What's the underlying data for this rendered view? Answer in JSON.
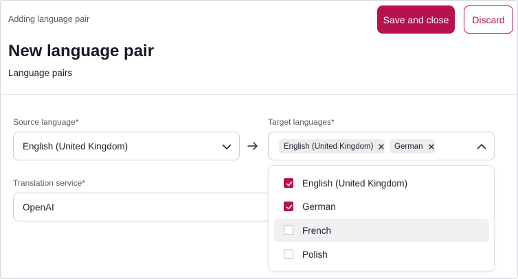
{
  "header": {
    "breadcrumb": "Adding language pair",
    "save_label": "Save and close",
    "discard_label": "Discard",
    "title": "New language pair",
    "subtitle": "Language pairs"
  },
  "form": {
    "source": {
      "label": "Source language*",
      "value": "English (United Kingdom)"
    },
    "target": {
      "label": "Target languages*",
      "chips": [
        "English (United Kingdom)",
        "German"
      ],
      "options": [
        {
          "label": "English (United Kingdom)",
          "checked": true
        },
        {
          "label": "German",
          "checked": true
        },
        {
          "label": "French",
          "checked": false
        },
        {
          "label": "Polish",
          "checked": false
        }
      ],
      "hovered_option": "French"
    },
    "service": {
      "label": "Translation service*",
      "value": "OpenAI"
    }
  },
  "colors": {
    "accent": "#b8114f",
    "hover_bg": "#f0f0f3",
    "chip_bg": "#ececef"
  },
  "icons": {
    "source_dropdown": "chevron-down-icon",
    "target_dropdown": "chevron-up-icon",
    "pair_arrow": "arrow-right-icon",
    "chip_remove": "close-icon",
    "checkbox_checked": "check-icon"
  }
}
